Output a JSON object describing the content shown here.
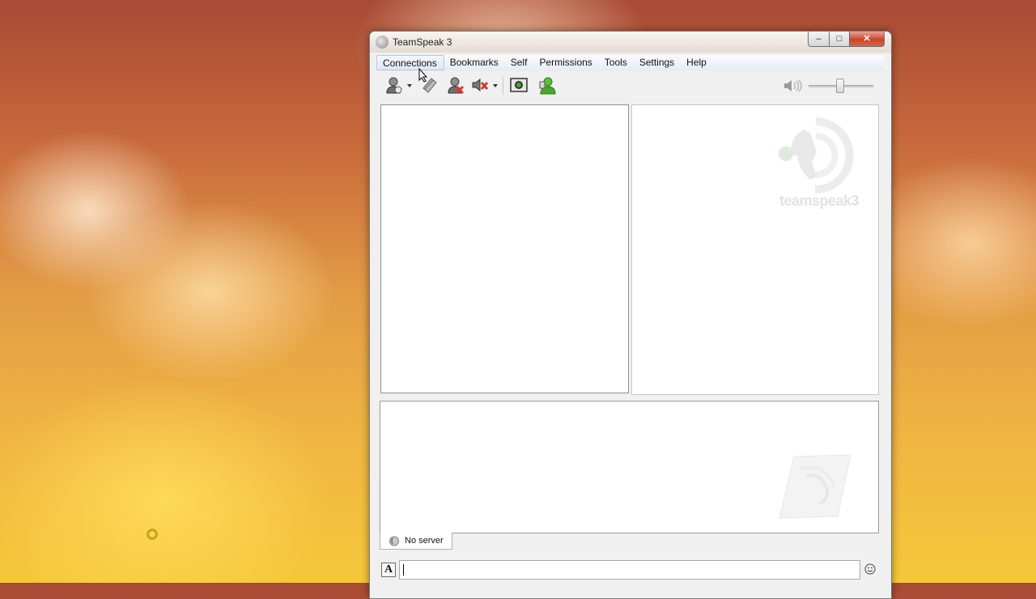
{
  "window": {
    "title": "TeamSpeak 3",
    "controls": {
      "minimize": "–",
      "maximize": "□",
      "close": "✕"
    }
  },
  "menu": {
    "items": [
      "Connections",
      "Bookmarks",
      "Self",
      "Permissions",
      "Tools",
      "Settings",
      "Help"
    ],
    "active": "Connections"
  },
  "toolbar": {
    "buttons": [
      "connect-icon",
      "away-icon",
      "disconnect-icon",
      "mute-speakers-icon",
      "capture-icon",
      "contacts-icon"
    ],
    "volume_icon": "speaker-icon",
    "volume_level": 0.5
  },
  "server_info": {
    "logo_text": "teamspeak3"
  },
  "tabs": [
    {
      "label": "No server",
      "icon": "teamspeak-icon"
    }
  ],
  "chat": {
    "input_value": "",
    "format_button": "A",
    "emoji_icon": "smiley-icon"
  },
  "colors": {
    "menu_highlight": "#dde7f3",
    "close_button": "#c7462f",
    "disconnect_red": "#d23a2a",
    "contacts_green": "#48a82e"
  }
}
